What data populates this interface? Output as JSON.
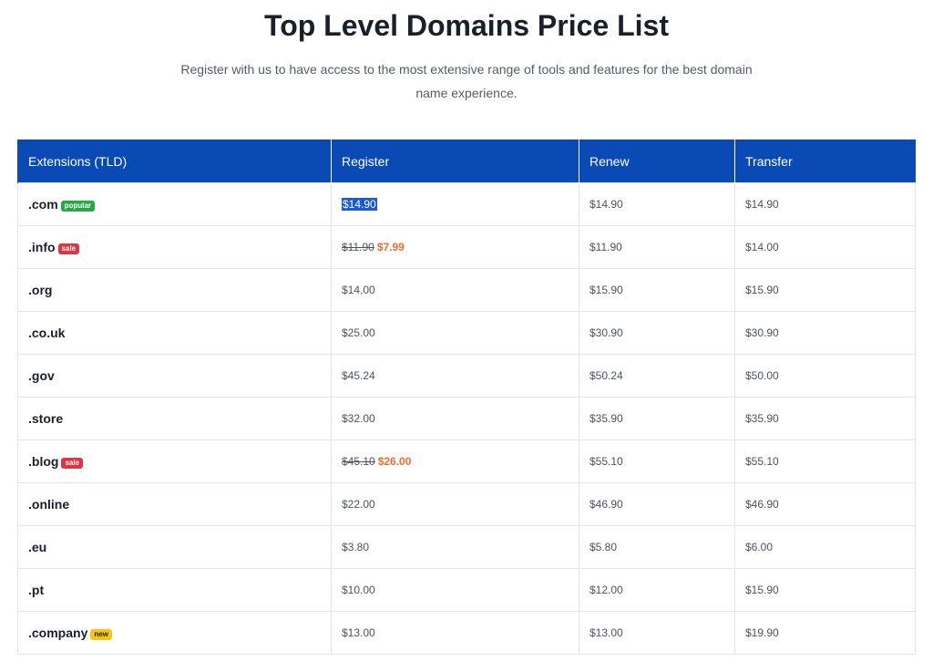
{
  "header": {
    "title": "Top Level Domains Price List",
    "subtitle_line1": "Register with us to have access to the most extensive range of tools and features for the best domain",
    "subtitle_line2": "name experience."
  },
  "table": {
    "columns": [
      "Extensions (TLD)",
      "Register",
      "Renew",
      "Transfer"
    ],
    "rows": [
      {
        "tld": ".com",
        "badge": "popular",
        "register": "$14.90",
        "register_old": "",
        "renew": "$14.90",
        "transfer": "$14.90"
      },
      {
        "tld": ".info",
        "badge": "sale",
        "register": "$7.99",
        "register_old": "$11.90",
        "renew": "$11.90",
        "transfer": "$14.00"
      },
      {
        "tld": ".org",
        "badge": "",
        "register": "$14.00",
        "register_old": "",
        "renew": "$15.90",
        "transfer": "$15.90"
      },
      {
        "tld": ".co.uk",
        "badge": "",
        "register": "$25.00",
        "register_old": "",
        "renew": "$30.90",
        "transfer": "$30.90"
      },
      {
        "tld": ".gov",
        "badge": "",
        "register": "$45.24",
        "register_old": "",
        "renew": "$50.24",
        "transfer": "$50.00"
      },
      {
        "tld": ".store",
        "badge": "",
        "register": "$32.00",
        "register_old": "",
        "renew": "$35.90",
        "transfer": "$35.90"
      },
      {
        "tld": ".blog",
        "badge": "sale",
        "register": "$26.00",
        "register_old": "$45.10",
        "renew": "$55.10",
        "transfer": "$55.10"
      },
      {
        "tld": ".online",
        "badge": "",
        "register": "$22.00",
        "register_old": "",
        "renew": "$46.90",
        "transfer": "$46.90"
      },
      {
        "tld": ".eu",
        "badge": "",
        "register": "$3.80",
        "register_old": "",
        "renew": "$5.80",
        "transfer": "$6.00"
      },
      {
        "tld": ".pt",
        "badge": "",
        "register": "$10.00",
        "register_old": "",
        "renew": "$12.00",
        "transfer": "$15.90"
      },
      {
        "tld": ".company",
        "badge": "new",
        "register": "$13.00",
        "register_old": "",
        "renew": "$13.00",
        "transfer": "$19.90"
      }
    ]
  },
  "colors": {
    "header_bg": "#0a4ab5",
    "popular_badge": "#28a745",
    "sale_badge": "#dc3545",
    "new_badge": "#f5c518",
    "sale_price": "#f06b2c",
    "selection": "#1a5ad6"
  }
}
